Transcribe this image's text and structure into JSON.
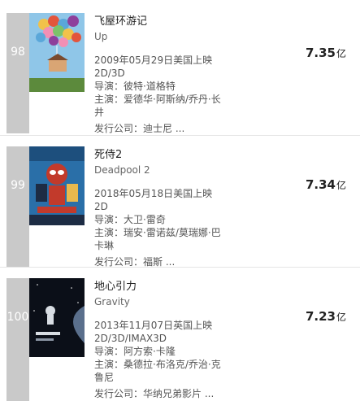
{
  "movies": [
    {
      "rank": "98",
      "title_cn": "飞屋环游记",
      "title_en": "Up",
      "release": "2009年05月29日美国上映 2D/3D",
      "director_label": "导演：",
      "director": "彼特·道格特",
      "cast_label": "主演：",
      "cast": "爱德华·阿斯纳/乔丹·长井",
      "company_label": "发行公司：",
      "company": "迪士尼 ...",
      "gross_value": "7.35",
      "gross_unit": "亿",
      "poster_colors": [
        "#f1c24a",
        "#e3553c",
        "#5aa7d9",
        "#8e3f9b",
        "#f28fb5",
        "#7cc36a"
      ]
    },
    {
      "rank": "99",
      "title_cn": "死侍2",
      "title_en": "Deadpool 2",
      "release": "2018年05月18日美国上映 2D",
      "director_label": "导演：",
      "director": "大卫·雷奇",
      "cast_label": "主演：",
      "cast": "瑞安·雷诺兹/莫瑞娜·巴卡琳",
      "company_label": "发行公司：",
      "company": "福斯 ...",
      "gross_value": "7.34",
      "gross_unit": "亿",
      "poster_colors": [
        "#2a6fa8",
        "#c23a2b",
        "#1d2c44",
        "#e9b94d"
      ]
    },
    {
      "rank": "100",
      "title_cn": "地心引力",
      "title_en": "Gravity",
      "release": "2013年11月07日英国上映 2D/3D/IMAX3D",
      "director_label": "导演：",
      "director": "阿方索·卡隆",
      "cast_label": "主演：",
      "cast": "桑德拉·布洛克/乔治·克鲁尼",
      "company_label": "发行公司：",
      "company": "华纳兄弟影片 ...",
      "gross_value": "7.23",
      "gross_unit": "亿",
      "poster_colors": [
        "#0b0f18",
        "#5a6f8c",
        "#d8dde3"
      ]
    }
  ]
}
